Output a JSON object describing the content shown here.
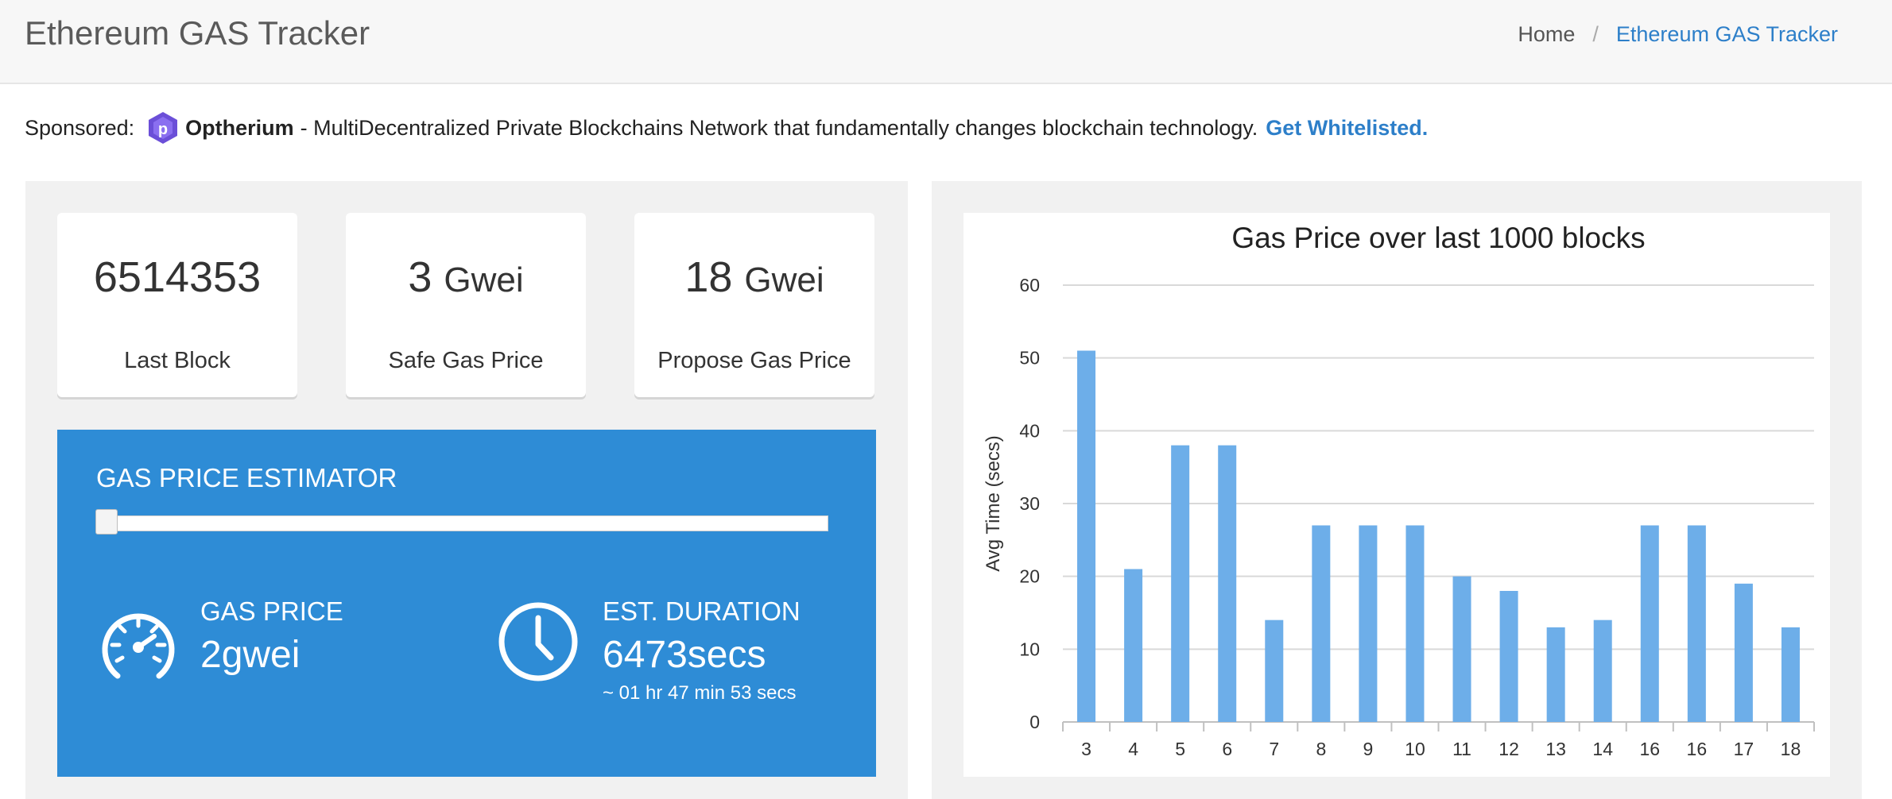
{
  "header": {
    "title": "Ethereum GAS Tracker",
    "breadcrumb": {
      "home": "Home",
      "separator": "/",
      "current": "Ethereum GAS Tracker"
    }
  },
  "sponsor": {
    "prefix": "Sponsored:",
    "brand": "Optherium",
    "text": "- MultiDecentralized Private Blockchains Network that fundamentally changes blockchain technology.",
    "cta": "Get Whitelisted."
  },
  "stats": [
    {
      "value": "6514353",
      "unit": "",
      "label": "Last Block"
    },
    {
      "value": "3",
      "unit": "Gwei",
      "label": "Safe Gas Price"
    },
    {
      "value": "18",
      "unit": "Gwei",
      "label": "Propose Gas Price"
    }
  ],
  "estimator": {
    "title": "GAS PRICE ESTIMATOR",
    "slider_level": 0,
    "gas_price_label": "GAS PRICE",
    "gas_price_value": "2gwei",
    "duration_label": "EST. DURATION",
    "duration_value": "6473secs",
    "duration_human": "~ 01 hr 47 min 53 secs"
  },
  "colors": {
    "accent": "#2e8cd6",
    "link": "#2d7fc9",
    "bar": "#6daee9"
  },
  "icons": [
    "logo-icon",
    "gauge-icon",
    "clock-icon"
  ],
  "chart_data": {
    "type": "bar",
    "title": "Gas Price over last 1000 blocks",
    "xlabel": "",
    "ylabel": "Avg Time (secs)",
    "categories": [
      "3",
      "4",
      "5",
      "6",
      "7",
      "8",
      "9",
      "10",
      "11",
      "12",
      "13",
      "14",
      "16",
      "16",
      "17",
      "18"
    ],
    "values": [
      51,
      21,
      38,
      38,
      14,
      27,
      27,
      27,
      20,
      18,
      13,
      14,
      27,
      27,
      19,
      13
    ],
    "ylim": [
      0,
      60
    ],
    "yticks": [
      0,
      10,
      20,
      30,
      40,
      50,
      60
    ],
    "grid": true,
    "legend": "none"
  }
}
